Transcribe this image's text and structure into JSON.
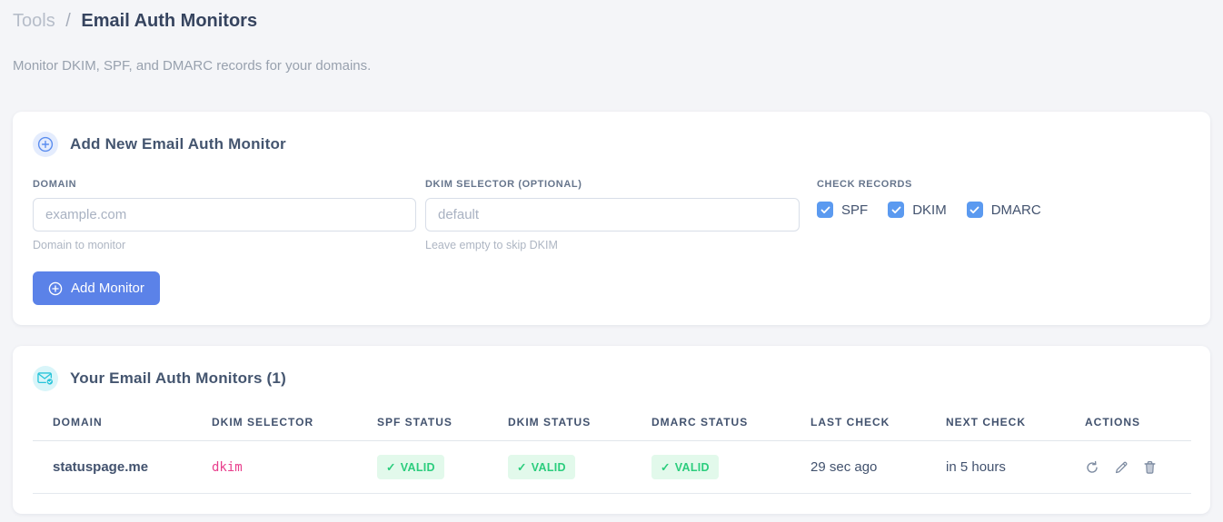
{
  "page": {
    "breadcrumb_root": "Tools",
    "breadcrumb_separator": "/",
    "title": "Email Auth Monitors",
    "subtitle": "Monitor DKIM, SPF, and DMARC records for your domains."
  },
  "add_card": {
    "icon": "plus-circle-icon",
    "title": "Add New Email Auth Monitor",
    "fields": {
      "domain": {
        "label": "DOMAIN",
        "placeholder": "example.com",
        "value": "",
        "help": "Domain to monitor"
      },
      "dkim_selector": {
        "label": "DKIM SELECTOR (OPTIONAL)",
        "placeholder": "default",
        "value": "",
        "help": "Leave empty to skip DKIM"
      }
    },
    "check_records": {
      "label": "CHECK RECORDS",
      "options": [
        {
          "label": "SPF",
          "checked": true
        },
        {
          "label": "DKIM",
          "checked": true
        },
        {
          "label": "DMARC",
          "checked": true
        }
      ]
    },
    "submit": {
      "icon": "plus-circle-icon",
      "label": "Add Monitor"
    }
  },
  "monitors_card": {
    "icon": "envelope-check-icon",
    "title": "Your Email Auth Monitors (1)",
    "table": {
      "headers": [
        "DOMAIN",
        "DKIM SELECTOR",
        "SPF STATUS",
        "DKIM STATUS",
        "DMARC STATUS",
        "LAST CHECK",
        "NEXT CHECK",
        "ACTIONS"
      ],
      "valid_glyph": "✓",
      "rows": [
        {
          "domain": "statuspage.me",
          "dkim_selector": "dkim",
          "spf_status": "VALID",
          "dkim_status": "VALID",
          "dmarc_status": "VALID",
          "last_check": "29 sec ago",
          "next_check": "in 5 hours",
          "actions": [
            "refresh-icon",
            "edit-icon",
            "delete-icon"
          ]
        }
      ]
    }
  },
  "colors": {
    "accent_blue": "#5b82e8",
    "checkbox_blue": "#5b9af0",
    "icon_blue": "#5b8def",
    "icon_cyan": "#27c4d9",
    "badge_green_bg": "#e2f9eb",
    "badge_green_text": "#2bcd7d",
    "code_pink": "#e83e8c"
  }
}
